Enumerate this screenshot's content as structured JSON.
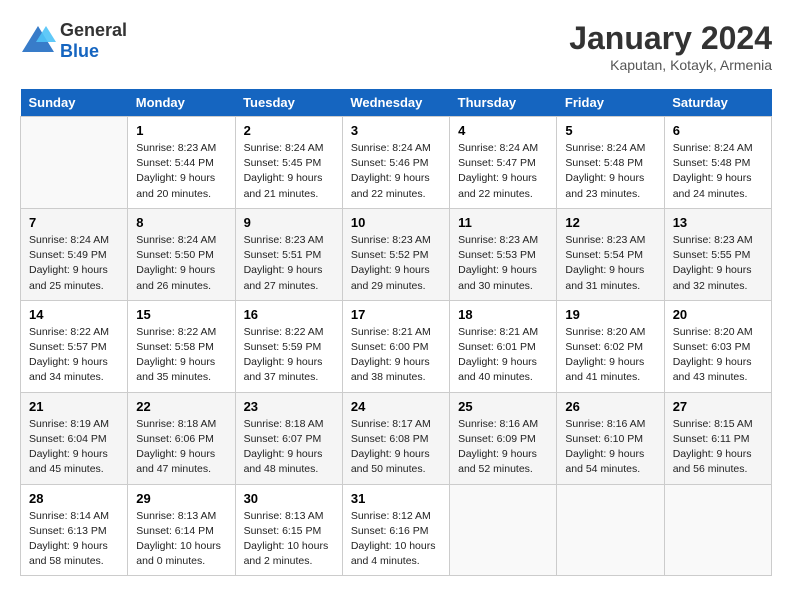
{
  "logo": {
    "general": "General",
    "blue": "Blue"
  },
  "title": "January 2024",
  "subtitle": "Kaputan, Kotayk, Armenia",
  "header_days": [
    "Sunday",
    "Monday",
    "Tuesday",
    "Wednesday",
    "Thursday",
    "Friday",
    "Saturday"
  ],
  "weeks": [
    [
      {
        "day": "",
        "info": ""
      },
      {
        "day": "1",
        "info": "Sunrise: 8:23 AM\nSunset: 5:44 PM\nDaylight: 9 hours\nand 20 minutes."
      },
      {
        "day": "2",
        "info": "Sunrise: 8:24 AM\nSunset: 5:45 PM\nDaylight: 9 hours\nand 21 minutes."
      },
      {
        "day": "3",
        "info": "Sunrise: 8:24 AM\nSunset: 5:46 PM\nDaylight: 9 hours\nand 22 minutes."
      },
      {
        "day": "4",
        "info": "Sunrise: 8:24 AM\nSunset: 5:47 PM\nDaylight: 9 hours\nand 22 minutes."
      },
      {
        "day": "5",
        "info": "Sunrise: 8:24 AM\nSunset: 5:48 PM\nDaylight: 9 hours\nand 23 minutes."
      },
      {
        "day": "6",
        "info": "Sunrise: 8:24 AM\nSunset: 5:48 PM\nDaylight: 9 hours\nand 24 minutes."
      }
    ],
    [
      {
        "day": "7",
        "info": "Sunrise: 8:24 AM\nSunset: 5:49 PM\nDaylight: 9 hours\nand 25 minutes."
      },
      {
        "day": "8",
        "info": "Sunrise: 8:24 AM\nSunset: 5:50 PM\nDaylight: 9 hours\nand 26 minutes."
      },
      {
        "day": "9",
        "info": "Sunrise: 8:23 AM\nSunset: 5:51 PM\nDaylight: 9 hours\nand 27 minutes."
      },
      {
        "day": "10",
        "info": "Sunrise: 8:23 AM\nSunset: 5:52 PM\nDaylight: 9 hours\nand 29 minutes."
      },
      {
        "day": "11",
        "info": "Sunrise: 8:23 AM\nSunset: 5:53 PM\nDaylight: 9 hours\nand 30 minutes."
      },
      {
        "day": "12",
        "info": "Sunrise: 8:23 AM\nSunset: 5:54 PM\nDaylight: 9 hours\nand 31 minutes."
      },
      {
        "day": "13",
        "info": "Sunrise: 8:23 AM\nSunset: 5:55 PM\nDaylight: 9 hours\nand 32 minutes."
      }
    ],
    [
      {
        "day": "14",
        "info": "Sunrise: 8:22 AM\nSunset: 5:57 PM\nDaylight: 9 hours\nand 34 minutes."
      },
      {
        "day": "15",
        "info": "Sunrise: 8:22 AM\nSunset: 5:58 PM\nDaylight: 9 hours\nand 35 minutes."
      },
      {
        "day": "16",
        "info": "Sunrise: 8:22 AM\nSunset: 5:59 PM\nDaylight: 9 hours\nand 37 minutes."
      },
      {
        "day": "17",
        "info": "Sunrise: 8:21 AM\nSunset: 6:00 PM\nDaylight: 9 hours\nand 38 minutes."
      },
      {
        "day": "18",
        "info": "Sunrise: 8:21 AM\nSunset: 6:01 PM\nDaylight: 9 hours\nand 40 minutes."
      },
      {
        "day": "19",
        "info": "Sunrise: 8:20 AM\nSunset: 6:02 PM\nDaylight: 9 hours\nand 41 minutes."
      },
      {
        "day": "20",
        "info": "Sunrise: 8:20 AM\nSunset: 6:03 PM\nDaylight: 9 hours\nand 43 minutes."
      }
    ],
    [
      {
        "day": "21",
        "info": "Sunrise: 8:19 AM\nSunset: 6:04 PM\nDaylight: 9 hours\nand 45 minutes."
      },
      {
        "day": "22",
        "info": "Sunrise: 8:18 AM\nSunset: 6:06 PM\nDaylight: 9 hours\nand 47 minutes."
      },
      {
        "day": "23",
        "info": "Sunrise: 8:18 AM\nSunset: 6:07 PM\nDaylight: 9 hours\nand 48 minutes."
      },
      {
        "day": "24",
        "info": "Sunrise: 8:17 AM\nSunset: 6:08 PM\nDaylight: 9 hours\nand 50 minutes."
      },
      {
        "day": "25",
        "info": "Sunrise: 8:16 AM\nSunset: 6:09 PM\nDaylight: 9 hours\nand 52 minutes."
      },
      {
        "day": "26",
        "info": "Sunrise: 8:16 AM\nSunset: 6:10 PM\nDaylight: 9 hours\nand 54 minutes."
      },
      {
        "day": "27",
        "info": "Sunrise: 8:15 AM\nSunset: 6:11 PM\nDaylight: 9 hours\nand 56 minutes."
      }
    ],
    [
      {
        "day": "28",
        "info": "Sunrise: 8:14 AM\nSunset: 6:13 PM\nDaylight: 9 hours\nand 58 minutes."
      },
      {
        "day": "29",
        "info": "Sunrise: 8:13 AM\nSunset: 6:14 PM\nDaylight: 10 hours\nand 0 minutes."
      },
      {
        "day": "30",
        "info": "Sunrise: 8:13 AM\nSunset: 6:15 PM\nDaylight: 10 hours\nand 2 minutes."
      },
      {
        "day": "31",
        "info": "Sunrise: 8:12 AM\nSunset: 6:16 PM\nDaylight: 10 hours\nand 4 minutes."
      },
      {
        "day": "",
        "info": ""
      },
      {
        "day": "",
        "info": ""
      },
      {
        "day": "",
        "info": ""
      }
    ]
  ]
}
